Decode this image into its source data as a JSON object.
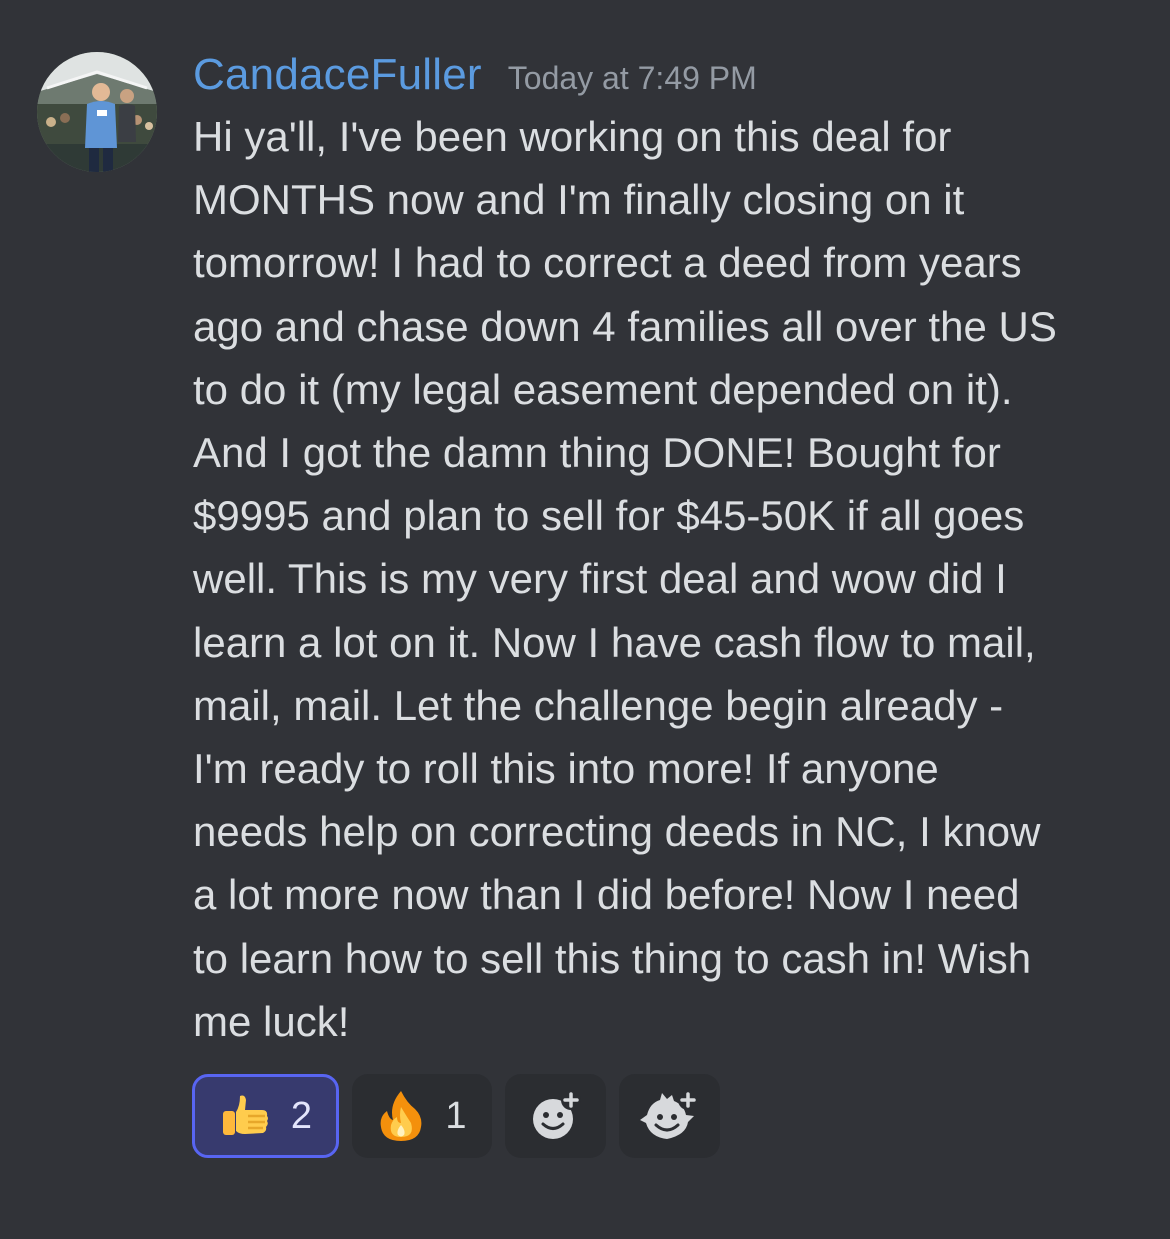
{
  "message": {
    "author": "CandaceFuller",
    "timestamp": "Today at 7:49 PM",
    "content": "Hi ya'll, I've been working on this deal for\nMONTHS now and I'm finally closing on it\ntomorrow!  I had to correct a deed from years\nago and chase down 4 families all over the US\nto do it (my legal easement depended on it).\nAnd I got the damn thing DONE!  Bought for\n$9995 and plan to sell for $45-50K if all goes\nwell.  This is my very first deal and wow did I\nlearn a lot on it.  Now I have cash flow to mail,\nmail, mail.  Let the challenge begin already -\nI'm ready to roll this into more!  If anyone\nneeds help on correcting deeds in NC, I know\na lot more now than I did before!  Now I need\nto learn how to sell this thing to cash in!  Wish\nme luck!"
  },
  "reactions": [
    {
      "emoji": "thumbs-up-icon",
      "count": "2",
      "selected": true
    },
    {
      "emoji": "fire-icon",
      "count": "1",
      "selected": false
    }
  ],
  "actions": [
    {
      "icon": "add-reaction-icon"
    },
    {
      "icon": "add-super-reaction-icon"
    }
  ],
  "colors": {
    "background": "#313338",
    "username": "#5b9be0",
    "timestamp": "#949ba4",
    "text": "#dbdee1",
    "reaction_bg": "#2b2d31",
    "reaction_selected_bg": "#373a6e",
    "reaction_selected_border": "#5865f2"
  }
}
